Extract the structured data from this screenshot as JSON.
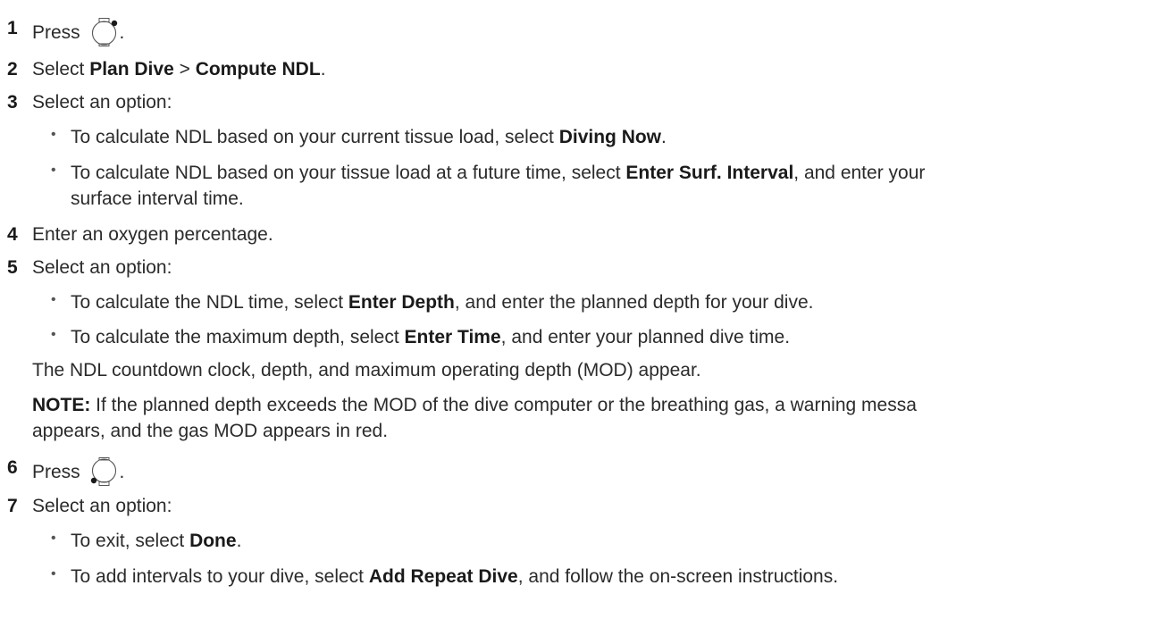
{
  "steps": [
    {
      "number": "1",
      "text": "Press",
      "after_icon": ".",
      "icon": "watch-button-top-right-icon"
    },
    {
      "number": "2",
      "parts": [
        "Select ",
        "Plan Dive",
        " > ",
        "Compute NDL",
        "."
      ]
    },
    {
      "number": "3",
      "text": "Select an option:"
    },
    {
      "number": "4",
      "text": "Enter an oxygen percentage."
    },
    {
      "number": "5",
      "text": "Select an option:"
    },
    {
      "number": "6",
      "text": "Press",
      "after_icon": ".",
      "icon": "watch-button-bottom-left-icon"
    },
    {
      "number": "7",
      "text": "Select an option:"
    }
  ],
  "step3_bullets": [
    {
      "parts": [
        "To calculate NDL based on your current tissue load, select ",
        "Diving Now",
        "."
      ]
    },
    {
      "parts": [
        "To calculate NDL based on your tissue load at a future time, select ",
        "Enter Surf. Interval",
        ", and enter your"
      ],
      "continuation": "surface interval time."
    }
  ],
  "step5_bullets": [
    {
      "parts": [
        "To calculate the NDL time, select ",
        "Enter Depth",
        ", and enter the planned depth for your dive."
      ]
    },
    {
      "parts": [
        "To calculate the maximum depth, select ",
        "Enter Time",
        ", and enter your planned dive time."
      ]
    }
  ],
  "step5_result": "The NDL countdown clock, depth, and maximum operating depth (MOD) appear.",
  "note": {
    "label": "NOTE:",
    "line1": " If the planned depth exceeds the MOD of the dive computer or the breathing gas, a warning messa",
    "line2": "appears, and the gas MOD appears in red."
  },
  "step7_bullets": [
    {
      "parts": [
        "To exit, select ",
        "Done",
        "."
      ]
    },
    {
      "parts": [
        "To add intervals to your dive, select ",
        "Add Repeat Dive",
        ", and follow the on-screen instructions."
      ]
    }
  ],
  "bullet_glyph": "•"
}
